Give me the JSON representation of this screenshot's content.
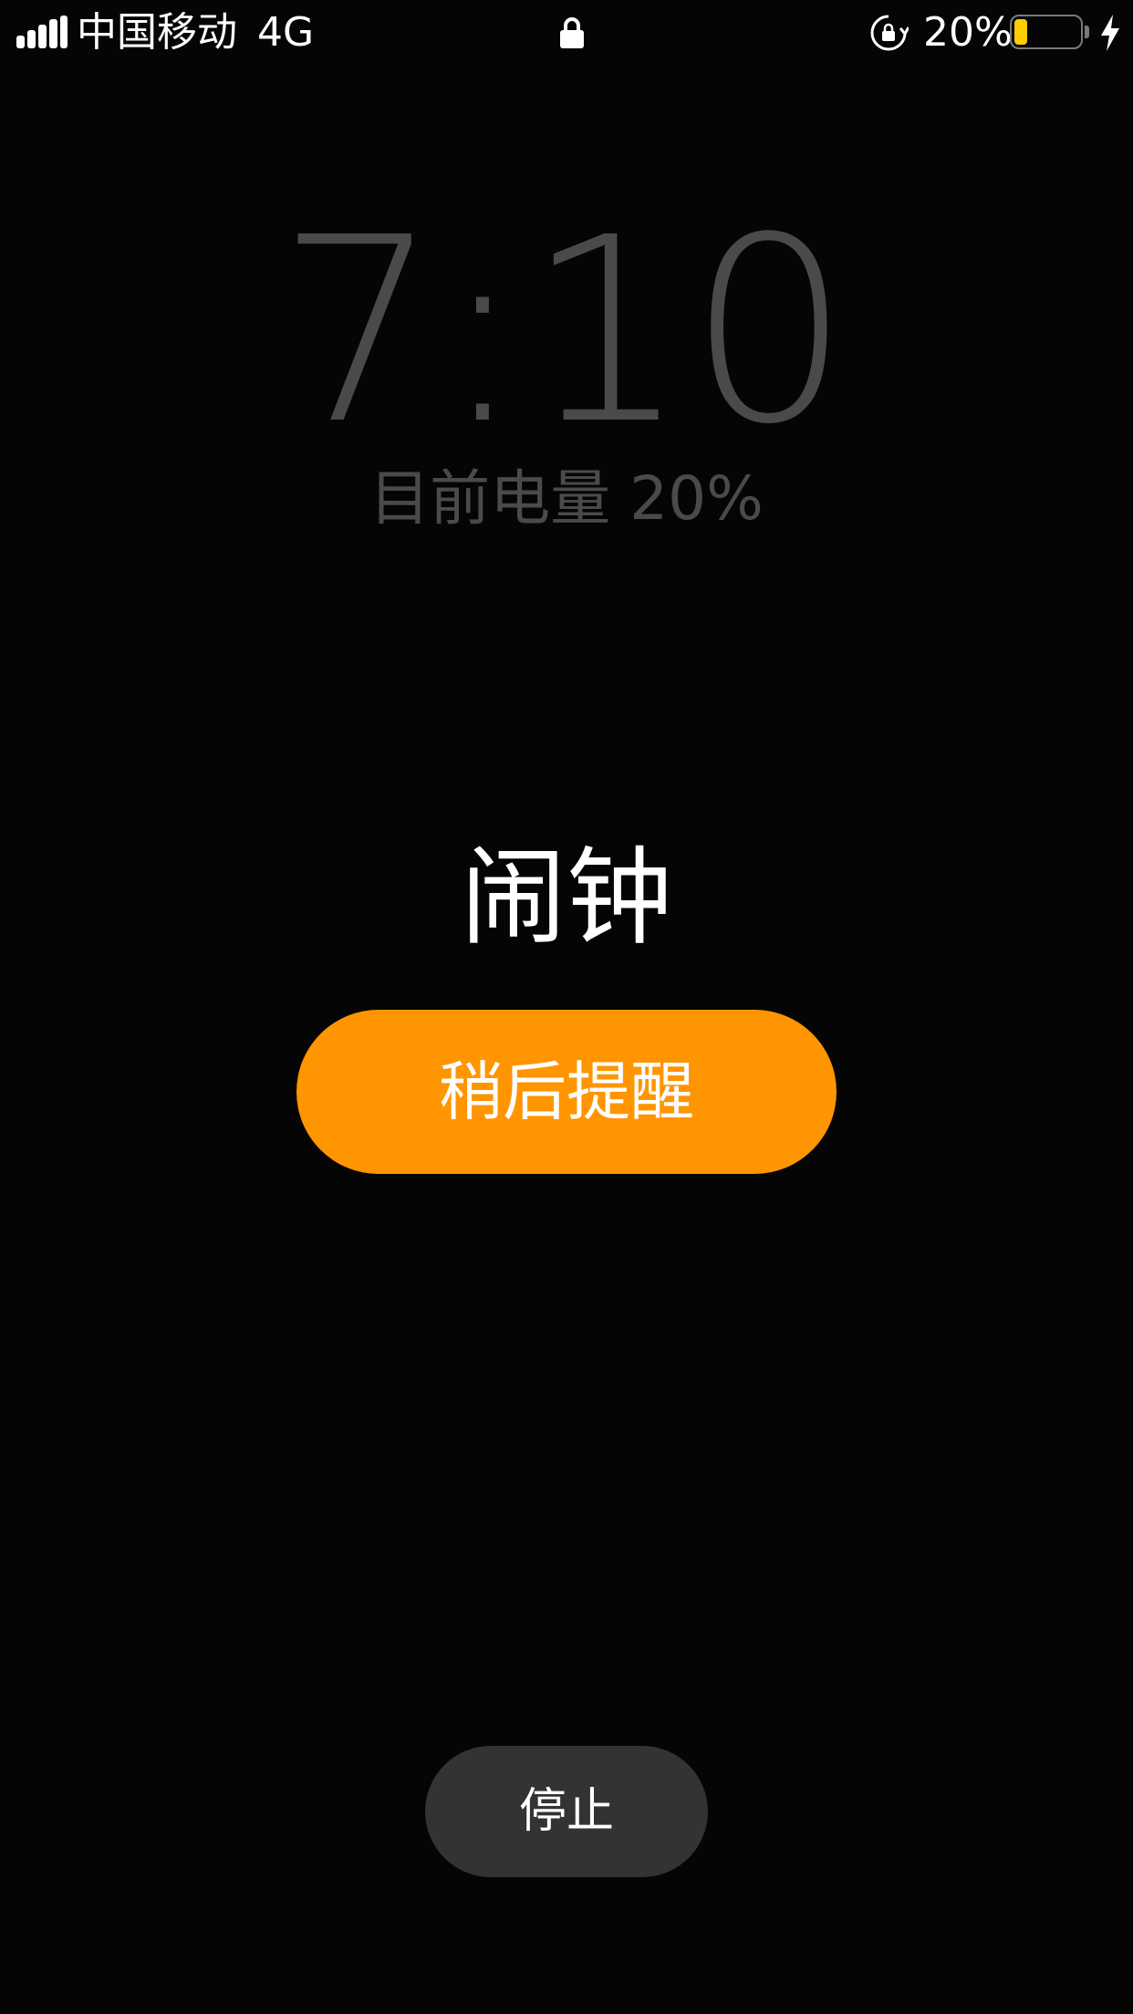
{
  "status_bar": {
    "signal_strength": 5,
    "signal_max": 5,
    "carrier": "中国移动",
    "network": "4G",
    "lock_icon": "lock-icon",
    "rotation_lock_icon": "rotation-lock-icon",
    "battery_percent": "20%",
    "battery_level": 0.2,
    "battery_color": "#ffcc00",
    "charging_icon": "bolt-icon"
  },
  "lock_screen": {
    "time": "7:10",
    "time_color": "#4a4a4a",
    "battery_status": "目前电量 20%"
  },
  "alarm": {
    "title": "闹钟",
    "snooze_label": "稍后提醒",
    "snooze_color": "#ff9500",
    "stop_label": "停止",
    "stop_color": "#333333"
  }
}
